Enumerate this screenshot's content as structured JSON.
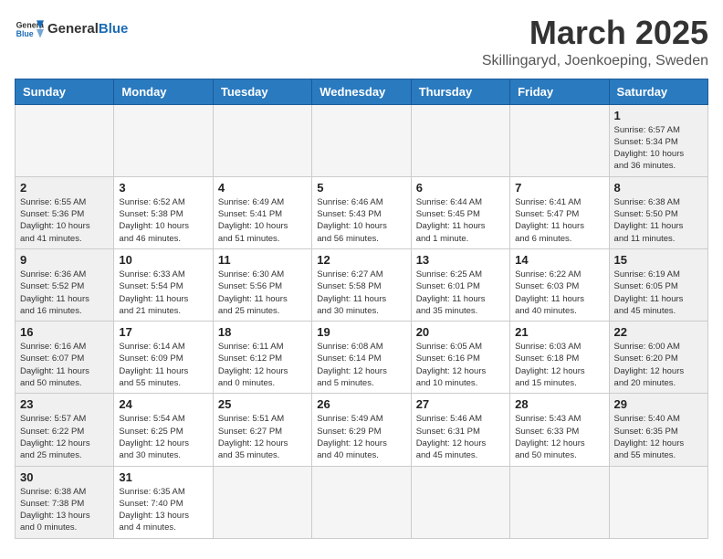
{
  "header": {
    "logo_general": "General",
    "logo_blue": "Blue",
    "month_title": "March 2025",
    "location": "Skillingaryd, Joenkoeping, Sweden"
  },
  "weekdays": [
    "Sunday",
    "Monday",
    "Tuesday",
    "Wednesday",
    "Thursday",
    "Friday",
    "Saturday"
  ],
  "weeks": [
    [
      {
        "day": "",
        "info": ""
      },
      {
        "day": "",
        "info": ""
      },
      {
        "day": "",
        "info": ""
      },
      {
        "day": "",
        "info": ""
      },
      {
        "day": "",
        "info": ""
      },
      {
        "day": "",
        "info": ""
      },
      {
        "day": "1",
        "info": "Sunrise: 6:57 AM\nSunset: 5:34 PM\nDaylight: 10 hours\nand 36 minutes."
      }
    ],
    [
      {
        "day": "2",
        "info": "Sunrise: 6:55 AM\nSunset: 5:36 PM\nDaylight: 10 hours\nand 41 minutes."
      },
      {
        "day": "3",
        "info": "Sunrise: 6:52 AM\nSunset: 5:38 PM\nDaylight: 10 hours\nand 46 minutes."
      },
      {
        "day": "4",
        "info": "Sunrise: 6:49 AM\nSunset: 5:41 PM\nDaylight: 10 hours\nand 51 minutes."
      },
      {
        "day": "5",
        "info": "Sunrise: 6:46 AM\nSunset: 5:43 PM\nDaylight: 10 hours\nand 56 minutes."
      },
      {
        "day": "6",
        "info": "Sunrise: 6:44 AM\nSunset: 5:45 PM\nDaylight: 11 hours\nand 1 minute."
      },
      {
        "day": "7",
        "info": "Sunrise: 6:41 AM\nSunset: 5:47 PM\nDaylight: 11 hours\nand 6 minutes."
      },
      {
        "day": "8",
        "info": "Sunrise: 6:38 AM\nSunset: 5:50 PM\nDaylight: 11 hours\nand 11 minutes."
      }
    ],
    [
      {
        "day": "9",
        "info": "Sunrise: 6:36 AM\nSunset: 5:52 PM\nDaylight: 11 hours\nand 16 minutes."
      },
      {
        "day": "10",
        "info": "Sunrise: 6:33 AM\nSunset: 5:54 PM\nDaylight: 11 hours\nand 21 minutes."
      },
      {
        "day": "11",
        "info": "Sunrise: 6:30 AM\nSunset: 5:56 PM\nDaylight: 11 hours\nand 25 minutes."
      },
      {
        "day": "12",
        "info": "Sunrise: 6:27 AM\nSunset: 5:58 PM\nDaylight: 11 hours\nand 30 minutes."
      },
      {
        "day": "13",
        "info": "Sunrise: 6:25 AM\nSunset: 6:01 PM\nDaylight: 11 hours\nand 35 minutes."
      },
      {
        "day": "14",
        "info": "Sunrise: 6:22 AM\nSunset: 6:03 PM\nDaylight: 11 hours\nand 40 minutes."
      },
      {
        "day": "15",
        "info": "Sunrise: 6:19 AM\nSunset: 6:05 PM\nDaylight: 11 hours\nand 45 minutes."
      }
    ],
    [
      {
        "day": "16",
        "info": "Sunrise: 6:16 AM\nSunset: 6:07 PM\nDaylight: 11 hours\nand 50 minutes."
      },
      {
        "day": "17",
        "info": "Sunrise: 6:14 AM\nSunset: 6:09 PM\nDaylight: 11 hours\nand 55 minutes."
      },
      {
        "day": "18",
        "info": "Sunrise: 6:11 AM\nSunset: 6:12 PM\nDaylight: 12 hours\nand 0 minutes."
      },
      {
        "day": "19",
        "info": "Sunrise: 6:08 AM\nSunset: 6:14 PM\nDaylight: 12 hours\nand 5 minutes."
      },
      {
        "day": "20",
        "info": "Sunrise: 6:05 AM\nSunset: 6:16 PM\nDaylight: 12 hours\nand 10 minutes."
      },
      {
        "day": "21",
        "info": "Sunrise: 6:03 AM\nSunset: 6:18 PM\nDaylight: 12 hours\nand 15 minutes."
      },
      {
        "day": "22",
        "info": "Sunrise: 6:00 AM\nSunset: 6:20 PM\nDaylight: 12 hours\nand 20 minutes."
      }
    ],
    [
      {
        "day": "23",
        "info": "Sunrise: 5:57 AM\nSunset: 6:22 PM\nDaylight: 12 hours\nand 25 minutes."
      },
      {
        "day": "24",
        "info": "Sunrise: 5:54 AM\nSunset: 6:25 PM\nDaylight: 12 hours\nand 30 minutes."
      },
      {
        "day": "25",
        "info": "Sunrise: 5:51 AM\nSunset: 6:27 PM\nDaylight: 12 hours\nand 35 minutes."
      },
      {
        "day": "26",
        "info": "Sunrise: 5:49 AM\nSunset: 6:29 PM\nDaylight: 12 hours\nand 40 minutes."
      },
      {
        "day": "27",
        "info": "Sunrise: 5:46 AM\nSunset: 6:31 PM\nDaylight: 12 hours\nand 45 minutes."
      },
      {
        "day": "28",
        "info": "Sunrise: 5:43 AM\nSunset: 6:33 PM\nDaylight: 12 hours\nand 50 minutes."
      },
      {
        "day": "29",
        "info": "Sunrise: 5:40 AM\nSunset: 6:35 PM\nDaylight: 12 hours\nand 55 minutes."
      }
    ],
    [
      {
        "day": "30",
        "info": "Sunrise: 6:38 AM\nSunset: 7:38 PM\nDaylight: 13 hours\nand 0 minutes."
      },
      {
        "day": "31",
        "info": "Sunrise: 6:35 AM\nSunset: 7:40 PM\nDaylight: 13 hours\nand 4 minutes."
      },
      {
        "day": "",
        "info": ""
      },
      {
        "day": "",
        "info": ""
      },
      {
        "day": "",
        "info": ""
      },
      {
        "day": "",
        "info": ""
      },
      {
        "day": "",
        "info": ""
      }
    ]
  ]
}
